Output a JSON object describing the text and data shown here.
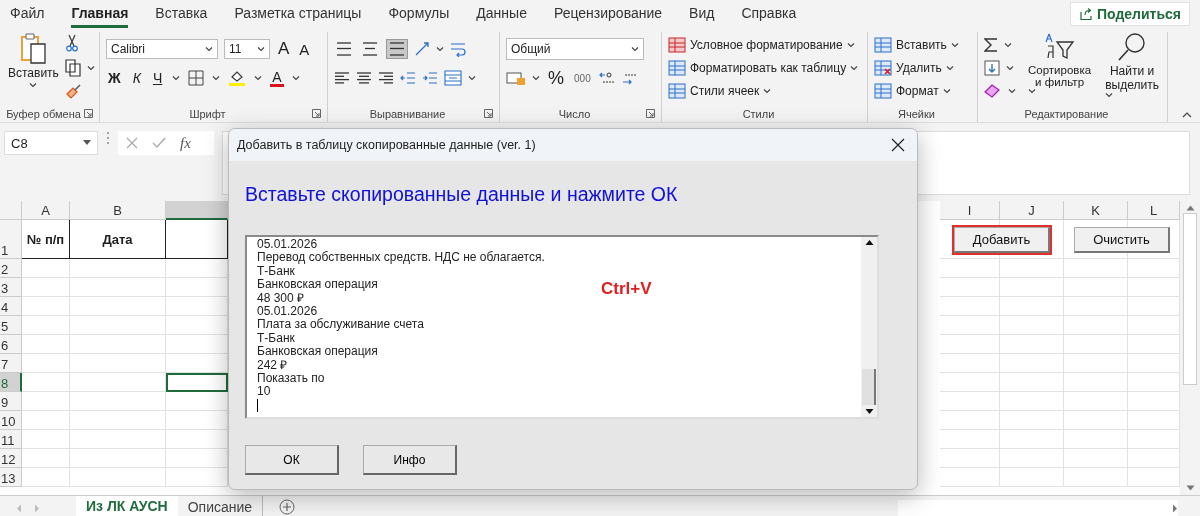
{
  "menu_tabs": [
    {
      "label": "Файл",
      "selected": false
    },
    {
      "label": "Главная",
      "selected": true
    },
    {
      "label": "Вставка",
      "selected": false
    },
    {
      "label": "Разметка страницы",
      "selected": false
    },
    {
      "label": "Формулы",
      "selected": false
    },
    {
      "label": "Данные",
      "selected": false
    },
    {
      "label": "Рецензирование",
      "selected": false
    },
    {
      "label": "Вид",
      "selected": false
    },
    {
      "label": "Справка",
      "selected": false
    }
  ],
  "share_button": {
    "label": "Поделиться"
  },
  "ribbon": {
    "clipboard": {
      "paste": "Вставить",
      "group": "Буфер обмена"
    },
    "font": {
      "family": "Calibri",
      "size": "11",
      "grow": "A",
      "shrink": "A",
      "bold": "Ж",
      "italic": "К",
      "underline": "Ч",
      "color_letter": "A",
      "group": "Шрифт"
    },
    "alignment": {
      "vertical": [
        {
          "selected": false
        },
        {
          "selected": false
        },
        {
          "selected": true
        }
      ],
      "group": "Выравнивание"
    },
    "number": {
      "format": "Общий",
      "percent": "%",
      "thousands": "000",
      "group": "Число"
    },
    "styles": {
      "items": [
        "Условное форматирование",
        "Форматировать как таблицу",
        "Стили ячеек"
      ],
      "group": "Стили"
    },
    "cells": {
      "items": [
        "Вставить",
        "Удалить",
        "Формат"
      ],
      "group": "Ячейки"
    },
    "editing": {
      "sort": "Сортировка и фильтр",
      "find": "Найти и выделить",
      "group": "Редактирование"
    }
  },
  "formula_bar": {
    "name_box": "C8",
    "fx": "fx"
  },
  "sheet": {
    "columns": [
      {
        "label": "A",
        "selected": false
      },
      {
        "label": "B",
        "selected": false
      },
      {
        "selected": true
      },
      {
        "label": "I",
        "selected": false
      },
      {
        "label": "J",
        "selected": false
      },
      {
        "label": "K",
        "selected": false
      },
      {
        "label": "L",
        "selected": false
      }
    ],
    "rows": [
      {
        "number": "1",
        "selected": false,
        "cells": [
          "№ п/п",
          "Дата"
        ]
      },
      {
        "number": "2",
        "selected": false
      },
      {
        "number": "3",
        "selected": false
      },
      {
        "number": "4",
        "selected": false
      },
      {
        "number": "5",
        "selected": false
      },
      {
        "number": "6",
        "selected": false
      },
      {
        "number": "7",
        "selected": false
      },
      {
        "number": "8",
        "selected": true
      },
      {
        "number": "9",
        "selected": false
      },
      {
        "number": "10",
        "selected": false
      },
      {
        "number": "11",
        "selected": false
      },
      {
        "number": "12",
        "selected": false
      },
      {
        "number": "13",
        "selected": false
      }
    ],
    "buttons": [
      {
        "label": "Добавить",
        "highlighted": true
      },
      {
        "label": "Очистить",
        "highlighted": false
      }
    ]
  },
  "sheet_tabs": [
    {
      "label": "Из ЛК АУСН",
      "selected": true
    },
    {
      "label": "Описание",
      "selected": false
    }
  ],
  "dialog": {
    "title": "Добавить в таблицу скопированные данные (ver. 1)",
    "heading": "Вставьте скопированные данные и нажмите ОК",
    "text_field": {
      "value": "05.01.2026\nПеревод собственных средств. НДС не облагается.\nТ-Банк\nБанковская операция\n48 300 ₽\n05.01.2026\nПлата за обслуживание счета\nТ-Банк\nБанковская операция\n242 ₽\nПоказать по\n10"
    },
    "annotation": "Ctrl+V",
    "buttons": [
      "ОК",
      "Инфо"
    ]
  }
}
